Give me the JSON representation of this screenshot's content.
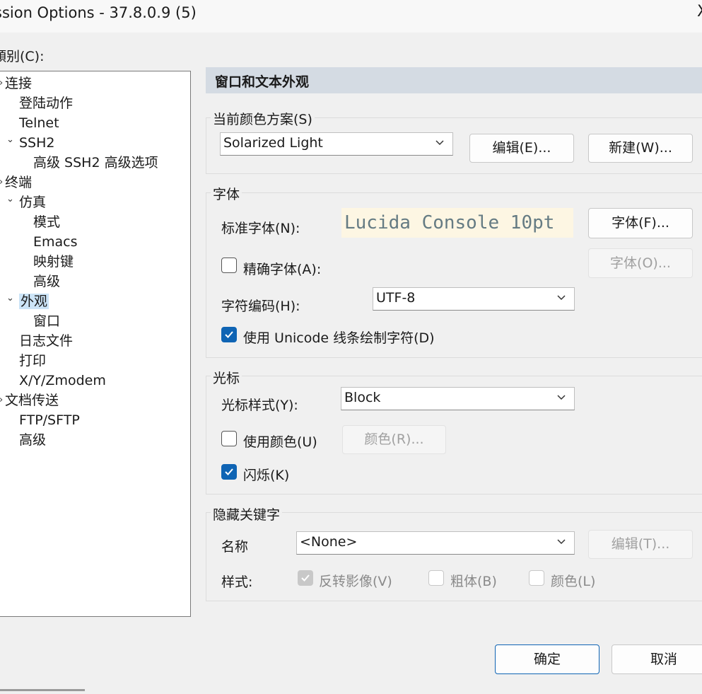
{
  "window": {
    "title": "ssion Options - 37.8.0.9 (5)",
    "close_glyph": "X"
  },
  "category_label": "類别(C):",
  "tree": [
    {
      "label": "连接",
      "chev": "›"
    },
    {
      "label": "登陆动作"
    },
    {
      "label": "Telnet"
    },
    {
      "label": "SSH2",
      "chev": "⌄"
    },
    {
      "label": "高级 SSH2 高级选项"
    },
    {
      "label": "终端",
      "chev": "›"
    },
    {
      "label": "仿真",
      "chev": "⌄"
    },
    {
      "label": "模式"
    },
    {
      "label": "Emacs"
    },
    {
      "label": "映射键"
    },
    {
      "label": "高级"
    },
    {
      "label": "外观",
      "chev": "⌄",
      "selected": true
    },
    {
      "label": "窗口"
    },
    {
      "label": "日志文件"
    },
    {
      "label": "打印"
    },
    {
      "label": "X/Y/Zmodem"
    },
    {
      "label": "文档传送",
      "chev": "›"
    },
    {
      "label": "FTP/SFTP"
    },
    {
      "label": "高级"
    }
  ],
  "panel": {
    "header": "窗口和文本外观",
    "color_scheme": {
      "group_title": "当前颜色方案(S)",
      "selected": "Solarized Light",
      "edit_button": "编辑(E)...",
      "new_button": "新建(W)..."
    },
    "font": {
      "group_title": "字体",
      "normal_font_label": "标准字体(N):",
      "font_preview": "Lucida Console 10pt",
      "font_button": "字体(F)...",
      "precise_font_label": "精确字体(A):",
      "precise_font_checked": false,
      "precise_font_button": "字体(O)...",
      "encoding_label": "字符编码(H):",
      "encoding_value": "UTF-8",
      "unicode_line_label": "使用 Unicode 线条绘制字符(D)",
      "unicode_line_checked": true
    },
    "cursor": {
      "group_title": "光标",
      "style_label": "光标样式(Y):",
      "style_value": "Block",
      "use_color_label": "使用颜色(U)",
      "use_color_checked": false,
      "color_button": "颜色(R)...",
      "blink_label": "闪烁(K)",
      "blink_checked": true
    },
    "keywords": {
      "group_title": "隐藏关键字",
      "name_label": "名称",
      "name_value": "<None>",
      "edit_button": "编辑(T)...",
      "style_label": "样式:",
      "reverse_label": "反转影像(V)",
      "reverse_checked": true,
      "bold_label": "粗体(B)",
      "bold_checked": false,
      "color_label": "颜色(L)",
      "color_checked": false
    }
  },
  "buttons": {
    "ok": "确定",
    "cancel": "取消"
  },
  "colors": {
    "accent": "#0f64b4",
    "preview_bg": "#fdf6e3",
    "preview_fg": "#657b83",
    "header_bg": "#d4dbe3"
  }
}
